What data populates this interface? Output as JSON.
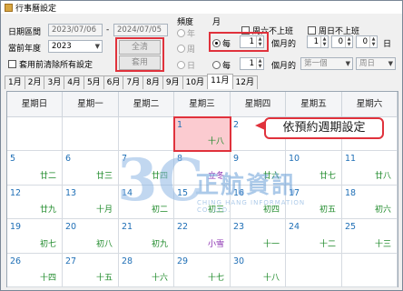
{
  "window": {
    "title": "行事曆設定"
  },
  "date_range": {
    "label": "日期區間",
    "start": "2023/07/06",
    "separator": "-",
    "end": "2024/07/05"
  },
  "current_year": {
    "label": "當前年度",
    "value": "2023"
  },
  "clear_checkbox": {
    "label": "套用前清除所有設定"
  },
  "buttons": {
    "all_apply": "全清",
    "apply": "套用"
  },
  "frequency": {
    "label": "頻度",
    "options": [
      "年",
      "周",
      "日"
    ]
  },
  "month_section": {
    "label": "月",
    "row1": {
      "radio": "每",
      "value": "1",
      "suffix": "個月的",
      "day1": "1",
      "day2": "0",
      "day3": "0",
      "unit": "日"
    },
    "row2": {
      "radio": "每",
      "value": "1",
      "suffix": "個月的",
      "week_select": "第一個",
      "day_select": "周日"
    }
  },
  "checkboxes": {
    "skip_saturday": "周六不上班",
    "skip_sunday": "周日不上班"
  },
  "tabs": [
    "1月",
    "2月",
    "3月",
    "4月",
    "5月",
    "6月",
    "7月",
    "8月",
    "9月",
    "10月",
    "11月",
    "12月"
  ],
  "active_tab_index": 10,
  "calendar": {
    "weekdays": [
      "星期日",
      "星期一",
      "星期二",
      "星期三",
      "星期四",
      "星期五",
      "星期六"
    ],
    "weeks": [
      [
        {
          "d": "",
          "l": ""
        },
        {
          "d": "",
          "l": ""
        },
        {
          "d": "",
          "l": ""
        },
        {
          "d": "1",
          "l": "十八",
          "hl": true
        },
        {
          "d": "2",
          "l": ""
        },
        {
          "d": "",
          "l": ""
        },
        {
          "d": "",
          "l": ""
        }
      ],
      [
        {
          "d": "5",
          "l": "廿二"
        },
        {
          "d": "6",
          "l": "廿三"
        },
        {
          "d": "7",
          "l": "廿四"
        },
        {
          "d": "8",
          "l": "立冬",
          "solar": true
        },
        {
          "d": "9",
          "l": "廿六"
        },
        {
          "d": "10",
          "l": "廿七"
        },
        {
          "d": "11",
          "l": "廿八"
        }
      ],
      [
        {
          "d": "12",
          "l": "廿九"
        },
        {
          "d": "13",
          "l": "十月"
        },
        {
          "d": "14",
          "l": "初二"
        },
        {
          "d": "15",
          "l": "初三"
        },
        {
          "d": "16",
          "l": "初四"
        },
        {
          "d": "17",
          "l": "初五"
        },
        {
          "d": "18",
          "l": "初六"
        }
      ],
      [
        {
          "d": "19",
          "l": "初七"
        },
        {
          "d": "20",
          "l": "初八"
        },
        {
          "d": "21",
          "l": "初九"
        },
        {
          "d": "22",
          "l": "小雪",
          "solar": true
        },
        {
          "d": "23",
          "l": "十一"
        },
        {
          "d": "24",
          "l": "十二"
        },
        {
          "d": "25",
          "l": "十三"
        }
      ],
      [
        {
          "d": "26",
          "l": "十四"
        },
        {
          "d": "27",
          "l": "十五"
        },
        {
          "d": "28",
          "l": "十六"
        },
        {
          "d": "29",
          "l": "十七"
        },
        {
          "d": "30",
          "l": "十八"
        },
        {
          "d": "",
          "l": ""
        },
        {
          "d": "",
          "l": ""
        }
      ]
    ]
  },
  "callout": {
    "text": "依預約週期設定"
  },
  "watermark": {
    "mark": "3C",
    "text": "正航資訊",
    "sub": "CHING HANG INFORMATION CO.,LTD."
  }
}
